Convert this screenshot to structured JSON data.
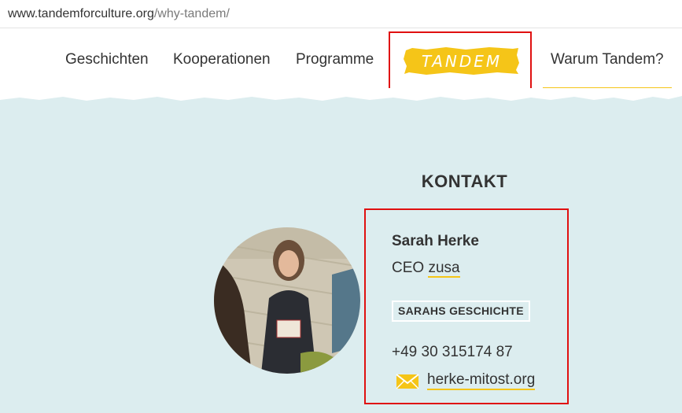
{
  "url": {
    "host": "www.tandemforculture.org",
    "path": "/why-tandem/"
  },
  "nav": {
    "items": [
      {
        "label": "Geschichten"
      },
      {
        "label": "Kooperationen"
      },
      {
        "label": "Programme"
      },
      {
        "label": "Warum Tandem?"
      }
    ],
    "logo_text": "TANDEM"
  },
  "contact": {
    "heading": "KONTAKT",
    "name": "Sarah Herke",
    "role_prefix": "CEO",
    "org": "zusa",
    "story_button": "SARAHS GESCHICHTE",
    "phone": "+49 30 315174 87",
    "email": "herke-mitost.org"
  },
  "colors": {
    "accent": "#f5c518",
    "background": "#dcedef",
    "highlight": "#e01010"
  }
}
